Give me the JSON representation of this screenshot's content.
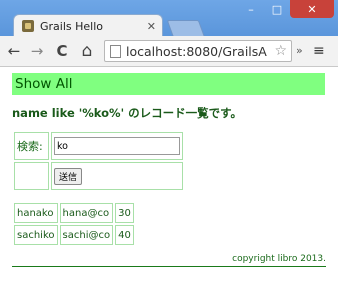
{
  "browser": {
    "tab_title": "Grails Hello",
    "url": "localhost:8080/GrailsA",
    "controls": {
      "minimize": "–",
      "maximize": "□",
      "close": "✕"
    },
    "nav": {
      "back": "←",
      "forward": "→",
      "reload": "C",
      "home": "⌂",
      "star": "☆",
      "extensions": "»",
      "menu": "≡"
    }
  },
  "page": {
    "title": "Show All",
    "message": "name like '%ko%' のレコード一覧です。",
    "search_form": {
      "label": "検索:",
      "value": "ko",
      "submit_label": "送信"
    },
    "records": [
      [
        "hanako",
        "hana@co",
        "30"
      ],
      [
        "sachiko",
        "sachi@co",
        "40"
      ]
    ],
    "footer": "copyright libro 2013."
  }
}
